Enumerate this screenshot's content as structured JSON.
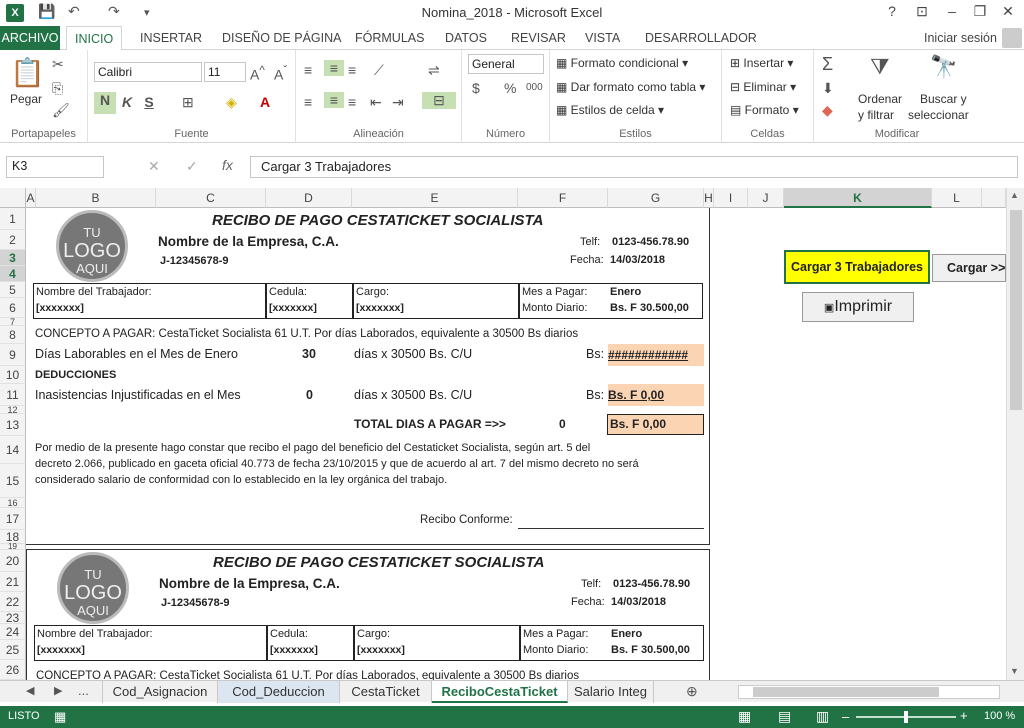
{
  "app": {
    "title": "Nomina_2018 - Microsoft Excel",
    "sign_in": "Iniciar sesión"
  },
  "titlebar": {
    "help": "?"
  },
  "tabs": [
    "ARCHIVO",
    "INICIO",
    "INSERTAR",
    "DISEÑO DE PÁGINA",
    "FÓRMULAS",
    "DATOS",
    "REVISAR",
    "VISTA",
    "DESARROLLADOR"
  ],
  "ribbon": {
    "clipboard": {
      "paste": "Pegar",
      "label": "Portapapeles"
    },
    "font": {
      "name": "Calibri",
      "size": "11",
      "bold": "N",
      "italic": "K",
      "underline": "S",
      "label": "Fuente"
    },
    "alignment": {
      "label": "Alineación"
    },
    "number": {
      "format": "General",
      "label": "Número",
      "currency": "$",
      "percent": "%",
      "thousands": "000"
    },
    "styles": {
      "conditional": "Formato condicional",
      "table": "Dar formato como tabla",
      "cell_styles": "Estilos de celda",
      "label": "Estilos"
    },
    "cells": {
      "insert": "Insertar",
      "delete": "Eliminar",
      "format": "Formato",
      "label": "Celdas"
    },
    "edit": {
      "sort1": "Ordenar",
      "sort2": "y filtrar",
      "find1": "Buscar y",
      "find2": "seleccionar",
      "label": "Modificar"
    }
  },
  "formula_bar": {
    "name_box": "K3",
    "content": "Cargar 3 Trabajadores",
    "fx": "fx"
  },
  "columns": [
    "A",
    "B",
    "C",
    "D",
    "E",
    "F",
    "G",
    "H",
    "I",
    "J",
    "K",
    "L"
  ],
  "rows": [
    "1",
    "2",
    "3",
    "4",
    "5",
    "6",
    "7",
    "8",
    "9",
    "10",
    "11",
    "12",
    "13",
    "14",
    "15",
    "16",
    "17",
    "18",
    "19",
    "20",
    "21",
    "22",
    "23",
    "24",
    "25",
    "26"
  ],
  "receipt": {
    "title": "RECIBO DE PAGO CESTATICKET SOCIALISTA",
    "logo": {
      "line1": "TU",
      "line2": "LOGO",
      "line3": "AQUI"
    },
    "company": "Nombre de la Empresa, C.A.",
    "rif": "J-12345678-9",
    "phone_label": "Telf:",
    "phone": "0123-456.78.90",
    "date_label": "Fecha:",
    "date": "14/03/2018",
    "worker_label": "Nombre del Trabajador:",
    "worker": "[xxxxxxx]",
    "id_label": "Cedula:",
    "id": "[xxxxxxx]",
    "role_label": "Cargo:",
    "role": "[xxxxxxx]",
    "month_label": "Mes a Pagar:",
    "month": "Enero",
    "amount_label": "Monto Diario:",
    "amount": "Bs. F 30.500,00",
    "concept": "CONCEPTO A PAGAR:  CestaTicket Socialista 61 U.T. Por días Laborados, equivalente a 30500 Bs diarios",
    "days_label": "Días Laborables en el Mes de Enero",
    "days": "30",
    "days_rate": "días x 30500 Bs.  C/U",
    "bs_label": "Bs:",
    "days_total": "############",
    "deductions": "DEDUCCIONES",
    "absences_label": "Inasistencias Injustificadas en el Mes",
    "absences": "0",
    "absences_rate": "días x 30500 Bs.  C/U",
    "absences_total": "Bs. F 0,00",
    "total_label": "TOTAL DIAS A PAGAR =>>",
    "total_days": "0",
    "total": "Bs. F 0,00",
    "legal1": "Por medio de la presente hago constar que recibo el pago del beneficio del Cestaticket Socialista, según art. 5 del",
    "legal2": "decreto 2.066, publicado en gaceta oficial 40.773 de fecha 23/10/2015 y que de acuerdo al art. 7 del mismo decreto no será",
    "legal3": "considerado salario de conformidad con lo establecido en la ley orgánica del trabajo.",
    "signature": "Recibo Conforme:"
  },
  "buttons": {
    "load3": "Cargar 3 Trabajadores",
    "load_more": "Cargar >>",
    "print": "Imprimir"
  },
  "sheet_tabs": [
    "Cod_Asignacion",
    "Cod_Deduccion",
    "CestaTicket",
    "ReciboCestaTicket",
    "Salario Integ"
  ],
  "sheet_nav": {
    "more": "..."
  },
  "status": {
    "ready": "LISTO",
    "zoom": "100 %"
  }
}
